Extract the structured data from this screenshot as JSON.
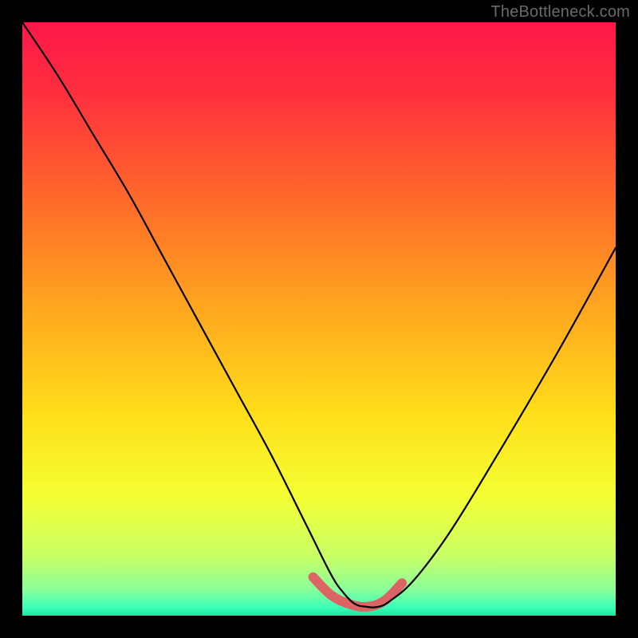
{
  "watermark": "TheBottleneck.com",
  "colors": {
    "background": "#000000",
    "curve": "#000000",
    "trough": "#dd6464",
    "watermark_text": "#6a6a6a",
    "gradient_stops": [
      {
        "offset": 0.0,
        "color": "#ff1749"
      },
      {
        "offset": 0.12,
        "color": "#ff2f3e"
      },
      {
        "offset": 0.3,
        "color": "#ff6a2a"
      },
      {
        "offset": 0.48,
        "color": "#ffa61f"
      },
      {
        "offset": 0.66,
        "color": "#ffde1a"
      },
      {
        "offset": 0.8,
        "color": "#f4ff33"
      },
      {
        "offset": 0.9,
        "color": "#c8ff66"
      },
      {
        "offset": 0.955,
        "color": "#8cff99"
      },
      {
        "offset": 0.985,
        "color": "#3fffb8"
      },
      {
        "offset": 1.0,
        "color": "#18e8a0"
      }
    ]
  },
  "chart_data": {
    "type": "line",
    "title": "",
    "xlabel": "",
    "ylabel": "",
    "xlim": [
      0,
      100
    ],
    "ylim": [
      0,
      100
    ],
    "grid": false,
    "legend_position": "none",
    "series": [
      {
        "name": "bottleneck-curve",
        "x": [
          0,
          6,
          12,
          18,
          24,
          30,
          36,
          42,
          48,
          52,
          54,
          56,
          58,
          60,
          62,
          66,
          72,
          80,
          90,
          100
        ],
        "values": [
          100,
          91,
          81,
          71,
          60,
          49,
          38,
          27,
          15,
          7,
          4,
          2,
          1.5,
          1.5,
          2.5,
          6,
          14,
          27,
          44,
          62
        ]
      }
    ],
    "annotations": [
      {
        "name": "optimal-trough",
        "x": [
          49,
          52,
          55,
          58,
          61,
          64
        ],
        "values": [
          6.5,
          3.5,
          2.0,
          1.5,
          2.5,
          5.5
        ]
      }
    ]
  }
}
